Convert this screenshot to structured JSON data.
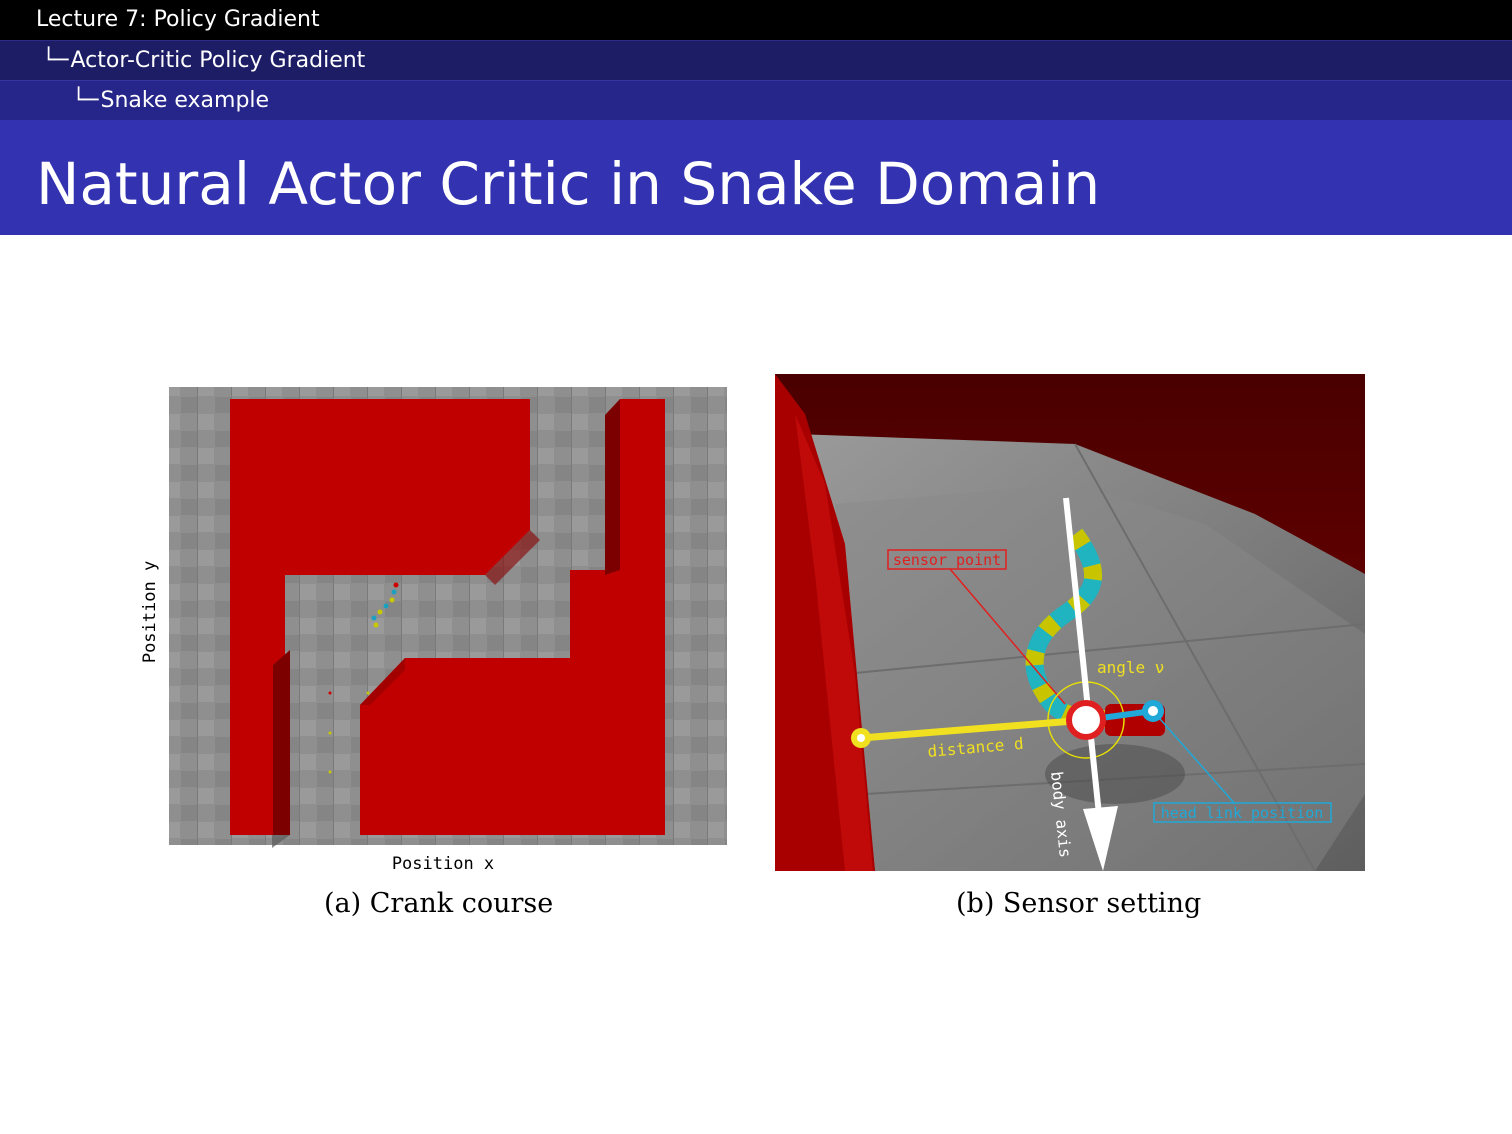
{
  "header": {
    "lecture": "Lecture 7: Policy Gradient",
    "section": "Actor-Critic Policy Gradient",
    "subsection": "Snake example"
  },
  "slide": {
    "title": "Natural Actor Critic in Snake Domain"
  },
  "figure_a": {
    "ylabel": "Position y",
    "xlabel": "Position x",
    "caption": "(a) Crank course"
  },
  "figure_b": {
    "sensor_point": "sensor point",
    "angle": "angle ν",
    "distance": "distance d",
    "body_axis": "body axis",
    "head_link": "head link position",
    "caption": "(b) Sensor setting"
  },
  "colors": {
    "wall_red": "#c00000",
    "floor_grey": "#8c8c8c",
    "title_blue": "#3333b2"
  }
}
